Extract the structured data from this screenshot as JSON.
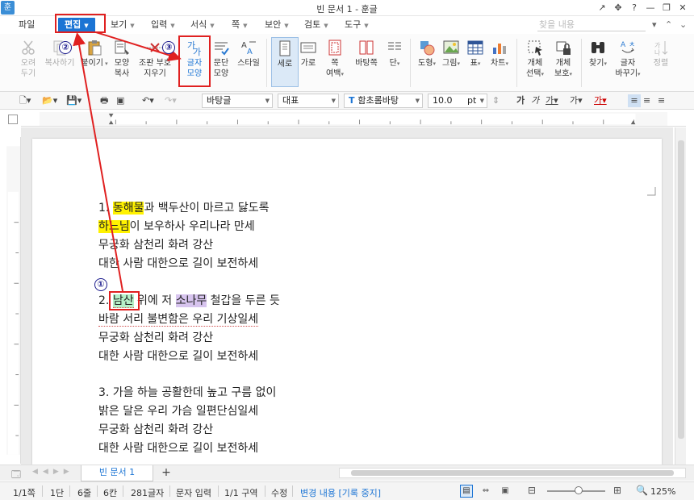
{
  "window": {
    "title": "빈 문서 1 - 훈글",
    "logo": "훈",
    "controls": [
      "↗",
      "✥",
      "?",
      "—",
      "❐",
      "✕"
    ]
  },
  "menu": {
    "file": "파일",
    "edit": "편집",
    "view": "보기",
    "insert": "입력",
    "format": "서식",
    "page": "쪽",
    "security": "보안",
    "review": "검토",
    "tools": "도구",
    "find_placeholder": "찾을 내용"
  },
  "ribbon": {
    "cut": "오려\n두기",
    "copy": "복사하기",
    "paste": "붙이기",
    "format_copy": "모양\n복사",
    "clear_marks": "조판 부호\n지우기",
    "char_shape": "글자\n모양",
    "para_shape": "문단\n모양",
    "style": "스타일",
    "portrait": "세로",
    "landscape": "가로",
    "page_margin": "쪽\n여백",
    "page_bg": "바탕쪽",
    "columns": "단",
    "shape": "도형",
    "picture": "그림",
    "table": "표",
    "chart": "차트",
    "obj_select": "개체\n선택",
    "obj_protect": "개체\n보호",
    "find": "찾기",
    "char_replace": "글자\n바꾸기",
    "align": "정렬"
  },
  "formatbar": {
    "style": "바탕글",
    "lang": "대표",
    "font": "함초롬바탕",
    "size": "10.0",
    "unit": "pt"
  },
  "doc": {
    "lines": [
      {
        "pre": "1. ",
        "hl": "동해물",
        "hl_color": "yellow",
        "post": "과 백두산이 마르고 닳도록"
      },
      {
        "pre": "",
        "hl": "하느님",
        "hl_color": "yellow",
        "post": "이 보우하사 우리나라 만세"
      },
      {
        "pre": "",
        "hl": "",
        "hl_color": "",
        "post": "무궁화 삼천리 화려 강산"
      },
      {
        "pre": "",
        "hl": "",
        "hl_color": "",
        "post": "대한 사람 대한으로 길이 보전하세"
      },
      {
        "pre": "2. ",
        "hl": "남산",
        "hl_color": "green",
        "mid": " 위에 저 ",
        "hl2": "소나무",
        "post": " 철갑을 두른 듯"
      },
      {
        "pre": "",
        "hl": "",
        "hl_color": "",
        "post": "바람 서리 불변함은 우리 기상일세"
      },
      {
        "pre": "",
        "hl": "",
        "hl_color": "",
        "post": "무궁화 삼천리 화려 강산"
      },
      {
        "pre": "",
        "hl": "",
        "hl_color": "",
        "post": "대한 사람 대한으로 길이 보전하세"
      },
      {
        "pre": "",
        "hl": "",
        "hl_color": "",
        "post": "3. 가을 하늘 공활한데 높고 구름 없이"
      },
      {
        "pre": "",
        "hl": "",
        "hl_color": "",
        "post": "밝은 달은 우리 가슴 일편단심일세"
      },
      {
        "pre": "",
        "hl": "",
        "hl_color": "",
        "post": "무궁화 삼천리 화려 강산"
      },
      {
        "pre": "",
        "hl": "",
        "hl_color": "",
        "post": "대한 사람 대한으로 길이 보전하세"
      }
    ]
  },
  "callouts": {
    "one": "①",
    "two": "②",
    "three": "③"
  },
  "tabs": {
    "doc_tab": "빈 문서 1",
    "add": "+"
  },
  "status": {
    "page": "1/1쪽",
    "column": "1단",
    "line": "6줄",
    "col": "6칸",
    "chars": "281글자",
    "mode": "문자 입력",
    "section": "1/1 구역",
    "insert": "수정",
    "track": "변경 내용 [기록 중지]",
    "zoom": "125%"
  },
  "colors": {
    "accent": "#1b74d4",
    "callout": "#e02020"
  }
}
